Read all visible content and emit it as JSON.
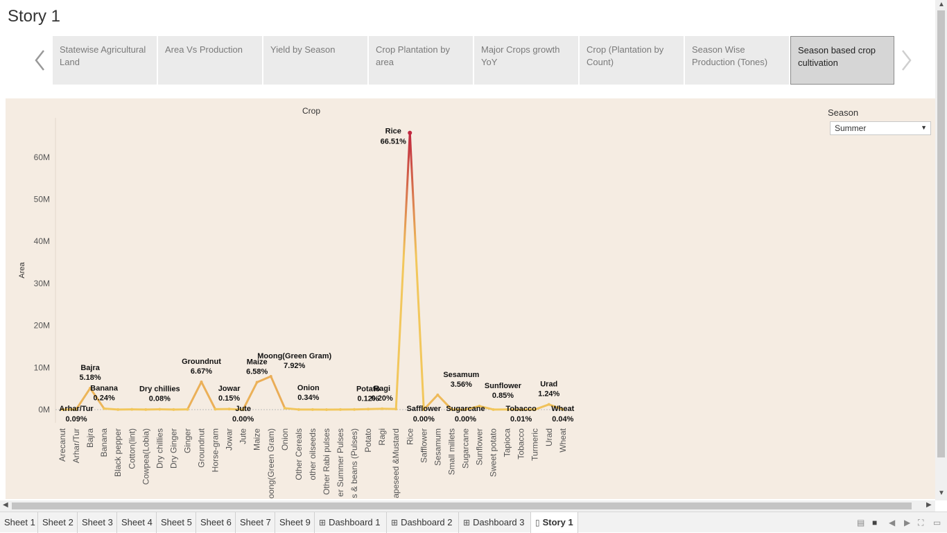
{
  "story": {
    "title": "Story 1",
    "points": [
      {
        "label": "Statewise Agricultural Land"
      },
      {
        "label": "Area Vs Production"
      },
      {
        "label": "Yield by Season"
      },
      {
        "label": "Crop Plantation by area"
      },
      {
        "label": "Major Crops growth YoY"
      },
      {
        "label": "Crop  (Plantation by Count)"
      },
      {
        "label": "Season Wise Production (Tones)"
      },
      {
        "label": "Season based crop cultivation"
      }
    ],
    "active_index": 7
  },
  "filter": {
    "label": "Season",
    "value": "Summer"
  },
  "chart_data": {
    "type": "line",
    "title": "Crop",
    "xlabel": "",
    "ylabel": "Area",
    "ylim": [
      0,
      67000000
    ],
    "y_ticks": [
      "0M",
      "10M",
      "20M",
      "30M",
      "40M",
      "50M",
      "60M"
    ],
    "grid": false,
    "color_range": [
      "#f2c75c",
      "#c0283f"
    ],
    "categories": [
      "Arecanut",
      "Arhar/Tur",
      "Bajra",
      "Banana",
      "Black pepper",
      "Cotton(lint)",
      "Cowpea(Lobia)",
      "Dry chillies",
      "Dry Ginger",
      "Ginger",
      "Groundnut",
      "Horse-gram",
      "Jowar",
      "Jute",
      "Maize",
      "Moong(Green Gram)",
      "Onion",
      "Other Cereals",
      "other oilseeds",
      "Other Rabi pulses",
      "Other Summer Pulses",
      "Peas & beans (Pulses)",
      "Potato",
      "Ragi",
      "Rapeseed &Mustard",
      "Rice",
      "Safflower",
      "Sesamum",
      "Small millets",
      "Sugarcane",
      "Sunflower",
      "Sweet potato",
      "Tapioca",
      "Tobacco",
      "Turmeric",
      "Urad",
      "Wheat"
    ],
    "tick_labels": [
      "Arecanut",
      "Arhar/Tur",
      "Bajra",
      "Banana",
      "Black pepper",
      "Cotton(lint)",
      "Cowpea(Lobia)",
      "Dry chillies",
      "Dry Ginger",
      "Ginger",
      "Groundnut",
      "Horse-gram",
      "Jowar",
      "Jute",
      "Maize",
      "oong(Green Gram)",
      "Onion",
      "Other Cereals",
      "other oilseeds",
      "Other Rabi pulses",
      "er Summer Pulses",
      "s & beans (Pulses)",
      "Potato",
      "Ragi",
      "apeseed &Mustard",
      "Rice",
      "Safflower",
      "Sesamum",
      "Small millets",
      "Sugarcane",
      "Sunflower",
      "Sweet potato",
      "Tapioca",
      "Tobacco",
      "Turmeric",
      "Urad",
      "Wheat"
    ],
    "values": [
      20000,
      90000,
      5100000,
      240000,
      30000,
      60000,
      20000,
      80000,
      20000,
      60000,
      6600000,
      100000,
      150000,
      5000,
      6500000,
      7900000,
      340000,
      30000,
      20000,
      10000,
      30000,
      50000,
      120000,
      200000,
      150000,
      65800000,
      5000,
      3500000,
      50000,
      5000,
      840000,
      30000,
      40000,
      10000,
      30000,
      1230000,
      40000
    ],
    "point_labels": [
      {
        "category": "Arhar/Tur",
        "name": "Arhar/Tur",
        "pct": "0.09%",
        "pos": "below"
      },
      {
        "category": "Bajra",
        "name": "Bajra",
        "pct": "5.18%",
        "pos": "above"
      },
      {
        "category": "Banana",
        "name": "Banana",
        "pct": "0.24%",
        "pos": "above"
      },
      {
        "category": "Dry chillies",
        "name": "Dry chillies",
        "pct": "0.08%",
        "pos": "above"
      },
      {
        "category": "Groundnut",
        "name": "Groundnut",
        "pct": "6.67%",
        "pos": "above"
      },
      {
        "category": "Jowar",
        "name": "Jowar",
        "pct": "0.15%",
        "pos": "above"
      },
      {
        "category": "Jute",
        "name": "Jute",
        "pct": "0.00%",
        "pos": "below"
      },
      {
        "category": "Maize",
        "name": "Maize",
        "pct": "6.58%",
        "pos": "above"
      },
      {
        "category": "Moong(Green Gram)",
        "name": "Moong(Green Gram)",
        "pct": "7.92%",
        "pos": "above-right"
      },
      {
        "category": "Onion",
        "name": "Onion",
        "pct": "0.34%",
        "pos": "above-right"
      },
      {
        "category": "Potato",
        "name": "Potato",
        "pct": "0.12%",
        "pos": "above"
      },
      {
        "category": "Ragi",
        "name": "Ragi",
        "pct": "0.20%",
        "pos": "above"
      },
      {
        "category": "Rice",
        "name": "Rice",
        "pct": "66.51%",
        "pos": "above-left"
      },
      {
        "category": "Safflower",
        "name": "Safflower",
        "pct": "0.00%",
        "pos": "below"
      },
      {
        "category": "Sesamum",
        "name": "Sesamum",
        "pct": "3.56%",
        "pos": "above-right"
      },
      {
        "category": "Sugarcane",
        "name": "Sugarcane",
        "pct": "0.00%",
        "pos": "below"
      },
      {
        "category": "Sunflower",
        "name": "Sunflower",
        "pct": "0.85%",
        "pos": "above-right"
      },
      {
        "category": "Tobacco",
        "name": "Tobacco",
        "pct": "0.01%",
        "pos": "below"
      },
      {
        "category": "Urad",
        "name": "Urad",
        "pct": "1.24%",
        "pos": "above"
      },
      {
        "category": "Wheat",
        "name": "Wheat",
        "pct": "0.04%",
        "pos": "below"
      }
    ]
  },
  "tabs": [
    {
      "label": "Sheet 1",
      "icon": ""
    },
    {
      "label": "Sheet 2",
      "icon": ""
    },
    {
      "label": "Sheet 3",
      "icon": ""
    },
    {
      "label": "Sheet 4",
      "icon": ""
    },
    {
      "label": "Sheet 5",
      "icon": ""
    },
    {
      "label": "Sheet 6",
      "icon": ""
    },
    {
      "label": "Sheet 7",
      "icon": ""
    },
    {
      "label": "Sheet 9",
      "icon": ""
    },
    {
      "label": "Dashboard 1",
      "icon": "dashboard-icon"
    },
    {
      "label": "Dashboard 2",
      "icon": "dashboard-icon"
    },
    {
      "label": "Dashboard 3",
      "icon": "dashboard-icon"
    },
    {
      "label": "Story 1",
      "icon": "story-icon"
    }
  ],
  "active_tab": "Story 1"
}
